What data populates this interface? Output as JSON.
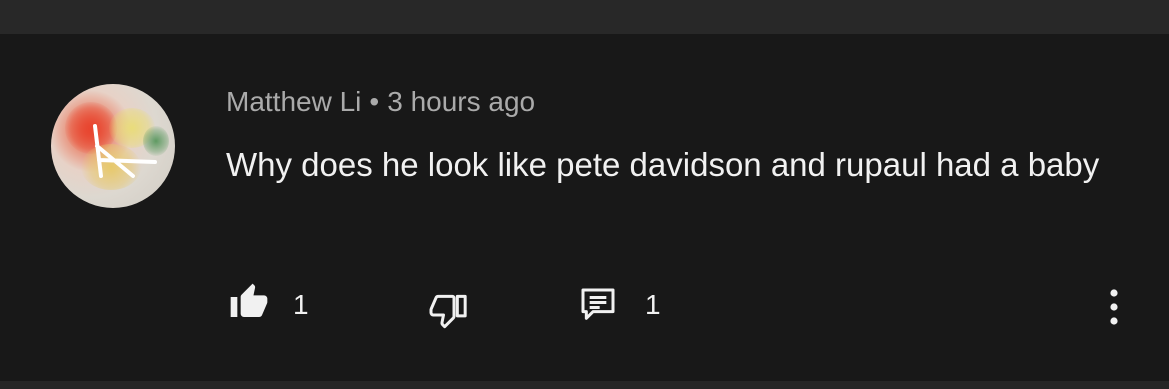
{
  "comment": {
    "author": "Matthew Li",
    "separator": "•",
    "timestamp": "3 hours ago",
    "text": "Why does he look like pete davidson and rupaul had a baby",
    "like_count": "1",
    "reply_count": "1"
  },
  "icons": {
    "like": "thumbs-up-icon",
    "dislike": "thumbs-down-icon",
    "reply": "comment-icon",
    "menu": "more-vertical-icon"
  },
  "colors": {
    "background": "#181818",
    "text_primary": "#f1f1f1",
    "text_secondary": "#aaaaaa"
  }
}
